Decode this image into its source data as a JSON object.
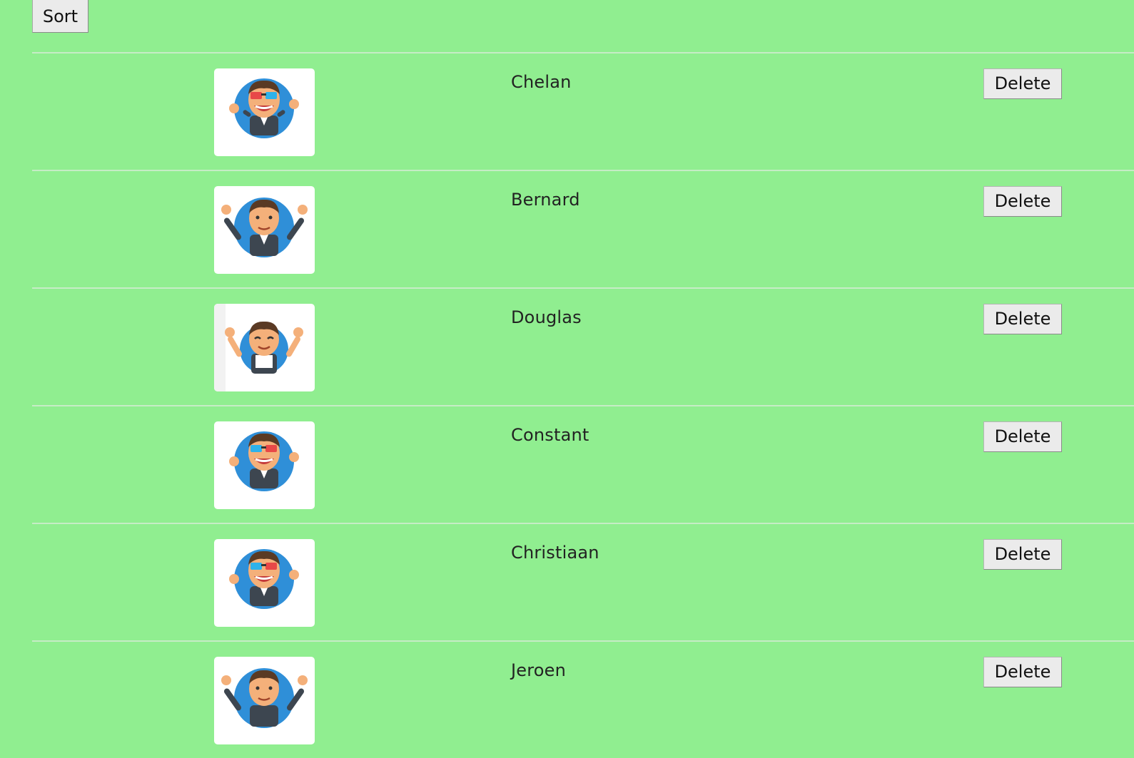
{
  "toolbar": {
    "sort_label": "Sort"
  },
  "colors": {
    "background": "#90ee90",
    "divider": "#c6ecc6",
    "button_face": "#ebebeb"
  },
  "people": [
    {
      "name": "Chelan",
      "delete_label": "Delete",
      "avatar": "businessman-3d-glasses-icon"
    },
    {
      "name": "Bernard",
      "delete_label": "Delete",
      "avatar": "businessman-waving-icon"
    },
    {
      "name": "Douglas",
      "delete_label": "Delete",
      "avatar": "businessman-happy-icon"
    },
    {
      "name": "Constant",
      "delete_label": "Delete",
      "avatar": "businessman-3d-glasses-icon"
    },
    {
      "name": "Christiaan",
      "delete_label": "Delete",
      "avatar": "businessman-3d-glasses-icon"
    },
    {
      "name": "Jeroen",
      "delete_label": "Delete",
      "avatar": "businessman-waving-icon"
    }
  ]
}
